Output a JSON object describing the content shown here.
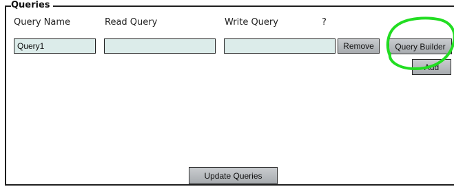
{
  "section": {
    "legend": "Queries"
  },
  "columns": {
    "name": "Query Name",
    "read": "Read Query",
    "write": "Write Query",
    "help": "?"
  },
  "row": {
    "name_value": "Query1",
    "read_value": "",
    "write_value": "",
    "remove_label": "Remove",
    "builder_label": "Query Builder"
  },
  "actions": {
    "add_label": "Add",
    "update_label": "Update Queries"
  },
  "colors": {
    "highlight": "#22dd22",
    "field_bg": "#dcecea",
    "button_bg": "#b7babd"
  },
  "icons": {
    "annotation": "highlight-circle"
  }
}
